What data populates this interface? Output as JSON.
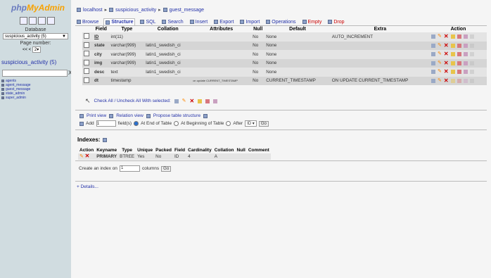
{
  "logo": {
    "part1": "php",
    "part2": "MyAdmin"
  },
  "sidebar": {
    "database_label": "Database",
    "database_value": "suspicious_activity (5)",
    "page_label": "Page number:",
    "page_nav": "<< <",
    "page_value": "2",
    "db_title": "suspicious_activity (5)",
    "filter_clear": "X",
    "tables": [
      "agents",
      "agent_message",
      "guest_message",
      "state_admin",
      "super_admin"
    ]
  },
  "breadcrumb": {
    "server": "localhost",
    "database": "suspicious_activity",
    "table": "guest_message",
    "sep": "▸"
  },
  "tabs": [
    {
      "label": "Browse",
      "red": false
    },
    {
      "label": "Structure",
      "red": false,
      "active": true
    },
    {
      "label": "SQL",
      "red": false
    },
    {
      "label": "Search",
      "red": false
    },
    {
      "label": "Insert",
      "red": false
    },
    {
      "label": "Export",
      "red": false
    },
    {
      "label": "Import",
      "red": false
    },
    {
      "label": "Operations",
      "red": false
    },
    {
      "label": "Empty",
      "red": true
    },
    {
      "label": "Drop",
      "red": true
    }
  ],
  "structure": {
    "headers": [
      "Field",
      "Type",
      "Collation",
      "Attributes",
      "Null",
      "Default",
      "Extra",
      "Action"
    ],
    "rows": [
      {
        "field": "ID",
        "underline": true,
        "type": "int(11)",
        "collation": "",
        "attributes": "",
        "null": "No",
        "default": "None",
        "extra": "AUTO_INCREMENT"
      },
      {
        "field": "state",
        "underline": false,
        "type": "varchar(999)",
        "collation": "latin1_swedish_ci",
        "attributes": "",
        "null": "No",
        "default": "None",
        "extra": ""
      },
      {
        "field": "city",
        "underline": false,
        "type": "varchar(999)",
        "collation": "latin1_swedish_ci",
        "attributes": "",
        "null": "No",
        "default": "None",
        "extra": ""
      },
      {
        "field": "img",
        "underline": false,
        "type": "varchar(999)",
        "collation": "latin1_swedish_ci",
        "attributes": "",
        "null": "No",
        "default": "None",
        "extra": ""
      },
      {
        "field": "desc",
        "underline": false,
        "type": "text",
        "collation": "latin1_swedish_ci",
        "attributes": "",
        "null": "No",
        "default": "None",
        "extra": ""
      },
      {
        "field": "dt",
        "underline": false,
        "type": "timestamp",
        "collation": "",
        "attributes": "on update CURRENT_TIMESTAMP",
        "null": "No",
        "default": "CURRENT_TIMESTAMP",
        "extra": "ON UPDATE CURRENT_TIMESTAMP"
      }
    ]
  },
  "check_all": "Check All / Uncheck All With selected:",
  "print_row": {
    "print": "Print view",
    "relation": "Relation view",
    "propose": "Propose table structure"
  },
  "add_row": {
    "add": "Add",
    "fields_value": "1",
    "fields": "field(s)",
    "end": "At End of Table",
    "beginning": "At Beginning of Table",
    "after": "After",
    "after_value": "ID",
    "go": "Go"
  },
  "indexes": {
    "title": "Indexes:",
    "headers": [
      "Action",
      "Keyname",
      "Type",
      "Unique",
      "Packed",
      "Field",
      "Cardinality",
      "Collation",
      "Null",
      "Comment"
    ],
    "rows": [
      {
        "keyname": "PRIMARY",
        "type": "BTREE",
        "unique": "Yes",
        "packed": "No",
        "field": "ID",
        "cardinality": "4",
        "collation": "A",
        "null": "",
        "comment": ""
      }
    ]
  },
  "create_index": {
    "label": "Create an index on",
    "value": "1",
    "columns": "columns",
    "go": "Go"
  },
  "details": "+ Details..."
}
